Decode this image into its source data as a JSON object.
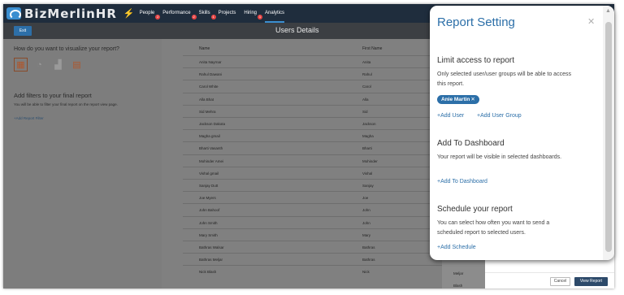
{
  "brand": {
    "name": "BizMerlinHR"
  },
  "nav": {
    "items": [
      {
        "label": "People",
        "badge": "2"
      },
      {
        "label": "Performance",
        "badge": "2"
      },
      {
        "label": "Skills",
        "badge": "1"
      },
      {
        "label": "Projects",
        "badge": ""
      },
      {
        "label": "Hiring",
        "badge": "1"
      },
      {
        "label": "Analytics",
        "badge": ""
      }
    ],
    "active": "Analytics"
  },
  "toolbar": {
    "exit_label": "Exit",
    "page_title": "Users Details"
  },
  "left_panel": {
    "visualize_question": "How do you want to visualize your report?",
    "chart_options": [
      "table-icon",
      "pie-chart-icon",
      "bar-chart-icon",
      "document-icon"
    ],
    "filters_heading": "Add filters to your final report",
    "filters_desc": "You will be able to filter your final report on the report view page.",
    "add_filter_link": "+Add Report Filter"
  },
  "table": {
    "columns": [
      "Name",
      "First Name"
    ],
    "rows": [
      [
        "Anita Nayrnar",
        "Anita"
      ],
      [
        "Rahul Dawani",
        "Rahul"
      ],
      [
        "Carol White",
        "Carol"
      ],
      [
        "Alla Bhat",
        "Alla"
      ],
      [
        "Sid Mehra",
        "Sid"
      ],
      [
        "Jackson Dakota",
        "Jackson"
      ],
      [
        "Magha gmail",
        "Magha"
      ],
      [
        "Bharti Vasanth",
        "Bharti"
      ],
      [
        "Mohinder Amei",
        "Mohinder"
      ],
      [
        "Vishal gmail",
        "Vishal"
      ],
      [
        "Sanjay Dutt",
        "Sanjay"
      ],
      [
        "Joe Myers",
        "Joe"
      ],
      [
        "John Bahoof",
        "John"
      ],
      [
        "John Smith",
        "John"
      ],
      [
        "Mary Smith",
        "Mary"
      ],
      [
        "Bathras Walsar",
        "Bathras"
      ],
      [
        "Bathras Meljar",
        "Bathras"
      ],
      [
        "Nick Blash",
        "Nick"
      ]
    ],
    "extra_visible_cells": [
      "Meljar",
      "Blash"
    ]
  },
  "footer": {
    "cancel_label": "Cancel",
    "view_label": "View Report"
  },
  "modal": {
    "title": "Report Setting",
    "close_icon": "close-icon",
    "access": {
      "heading": "Limit access to report",
      "desc": "Only selected user/user groups will be able to access this report.",
      "chip": "Anie Martin",
      "add_user": "+Add User",
      "add_group": "+Add User Group"
    },
    "dashboard": {
      "heading": "Add To Dashboard",
      "desc": "Your report will be visible in selected dashboards.",
      "add_link": "+Add To Dashboard"
    },
    "schedule": {
      "heading": "Schedule your report",
      "desc": "You can select how often you want to send a scheduled report to selected users.",
      "add_link": "+Add Schedule"
    }
  },
  "colors": {
    "accent": "#2c6fa8",
    "nav_bg": "#1f2d3d",
    "badge": "#e84545"
  }
}
